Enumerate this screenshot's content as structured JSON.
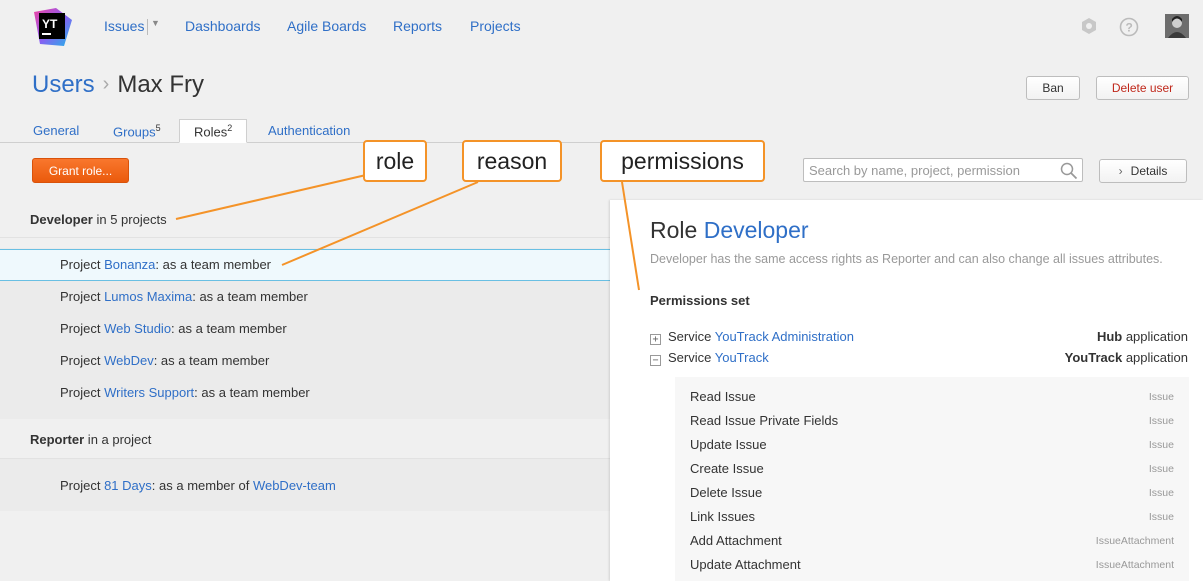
{
  "nav": {
    "logo_text": "YT",
    "items": [
      "Issues",
      "Dashboards",
      "Agile Boards",
      "Reports",
      "Projects"
    ]
  },
  "header": {
    "breadcrumb_root": "Users",
    "breadcrumb_sep": "›",
    "user_name": "Max Fry",
    "ban_label": "Ban",
    "delete_label": "Delete user"
  },
  "tabs": [
    {
      "label": "General",
      "count": ""
    },
    {
      "label": "Groups",
      "count": "5"
    },
    {
      "label": "Roles",
      "count": "2"
    },
    {
      "label": "Authentication",
      "count": ""
    }
  ],
  "toolbar": {
    "grant_label": "Grant role...",
    "search_placeholder": "Search by name, project, permission",
    "details_label": "Details"
  },
  "groups": [
    {
      "role": "Developer",
      "suffix": " in 5 projects",
      "rows": [
        {
          "prefix": "Project ",
          "project": "Bonanza",
          "reason": ": as a team member",
          "team": ""
        },
        {
          "prefix": "Project ",
          "project": "Lumos Maxima",
          "reason": ": as a team member",
          "team": ""
        },
        {
          "prefix": "Project ",
          "project": "Web Studio",
          "reason": ": as a team member",
          "team": ""
        },
        {
          "prefix": "Project ",
          "project": "WebDev",
          "reason": ": as a team member",
          "team": ""
        },
        {
          "prefix": "Project ",
          "project": "Writers Support",
          "reason": ": as a team member",
          "team": ""
        }
      ]
    },
    {
      "role": "Reporter",
      "suffix": " in a project",
      "rows": [
        {
          "prefix": "Project ",
          "project": "81 Days",
          "reason": ": as a member of ",
          "team": "WebDev-team"
        }
      ]
    }
  ],
  "panel": {
    "title_prefix": "Role ",
    "role_name": "Developer",
    "description": "Developer has the same access rights as Reporter and can also change all issues attributes.",
    "permissions_heading": "Permissions set",
    "services": [
      {
        "toggle": "+",
        "prefix": "Service ",
        "name": "YouTrack Administration",
        "app_bold": "Hub",
        "app_suffix": " application"
      },
      {
        "toggle": "−",
        "prefix": "Service ",
        "name": "YouTrack",
        "app_bold": "YouTrack",
        "app_suffix": " application"
      }
    ],
    "permissions": [
      {
        "name": "Read Issue",
        "kind": "Issue"
      },
      {
        "name": "Read Issue Private Fields",
        "kind": "Issue"
      },
      {
        "name": "Update Issue",
        "kind": "Issue"
      },
      {
        "name": "Create Issue",
        "kind": "Issue"
      },
      {
        "name": "Delete Issue",
        "kind": "Issue"
      },
      {
        "name": "Link Issues",
        "kind": "Issue"
      },
      {
        "name": "Add Attachment",
        "kind": "IssueAttachment"
      },
      {
        "name": "Update Attachment",
        "kind": "IssueAttachment"
      }
    ]
  },
  "annotations": {
    "role": "role",
    "reason": "reason",
    "permissions": "permissions",
    "color": "#f49328"
  },
  "colors": {
    "link": "#2f6fc7",
    "accent": "#ea5a0c",
    "danger": "#c0281b"
  }
}
